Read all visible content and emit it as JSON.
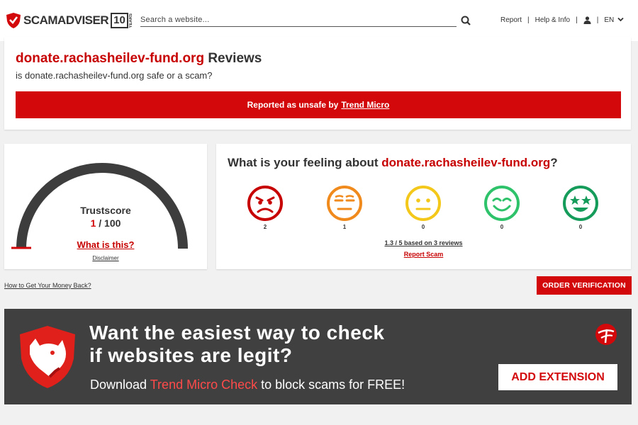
{
  "header": {
    "logo_text": "SCAMADVISER",
    "logo_badge": "10",
    "logo_years": "YEARS",
    "search_placeholder": "Search a website...",
    "nav": {
      "report": "Report",
      "help": "Help & Info",
      "lang": "EN"
    }
  },
  "site": {
    "domain": "donate.rachasheilev-fund.org",
    "title_suffix": " Reviews",
    "subtitle": "is donate.rachasheilev-fund.org safe or a scam?",
    "alert_prefix": "Reported as unsafe by",
    "alert_link": "Trend Micro"
  },
  "trust": {
    "label": "Trustscore",
    "score": "1",
    "score_max": " / 100",
    "score_value": 1,
    "what_link": "What is this?",
    "disclaimer": "Disclaimer"
  },
  "feeling": {
    "prefix": "What is your feeling about ",
    "suffix": "?",
    "faces": [
      {
        "icon": "angry-face-icon",
        "color": "#c70000",
        "count": "2"
      },
      {
        "icon": "unhappy-face-icon",
        "color": "#f08a1c",
        "count": "1"
      },
      {
        "icon": "neutral-face-icon",
        "color": "#f4c81b",
        "count": "0"
      },
      {
        "icon": "happy-face-icon",
        "color": "#2ec26a",
        "count": "0"
      },
      {
        "icon": "star-eyes-face-icon",
        "color": "#159c5b",
        "count": "0"
      }
    ],
    "rating_text": "1.3 / 5 based on 3 reviews",
    "report_link": "Report Scam"
  },
  "money_link": "How to Get Your Money Back?",
  "order_button": "ORDER VERIFICATION",
  "banner": {
    "headline_line1": "Want the easiest way to check",
    "headline_line2": "if websites are legit?",
    "sub_prefix": "Download ",
    "sub_highlight": "Trend Micro Check",
    "sub_suffix": " to block scams for FREE!",
    "button": "ADD EXTENSION"
  },
  "colors": {
    "brand_red": "#d2080b",
    "banner_bg": "#404040",
    "gauge_gray": "#3d3d3d"
  }
}
